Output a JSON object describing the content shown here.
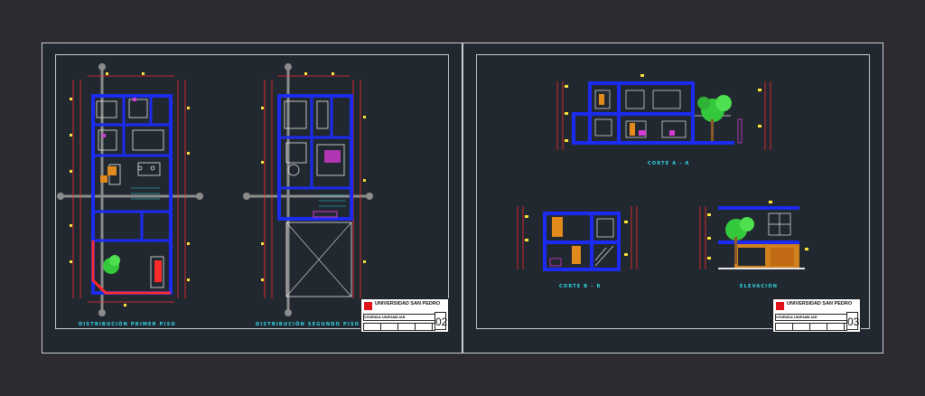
{
  "sheets": [
    {
      "captions": {
        "first_floor": "DISTRIBUCIÓN PRIMER PISO",
        "second_floor": "DISTRIBUCIÓN SEGUNDO PISO"
      },
      "title_block": {
        "university": "UNIVERSIDAD SAN PEDRO",
        "project": "VIVIENDA UNIFAMILIAR",
        "sheet_number": "02"
      }
    },
    {
      "captions": {
        "section_aa": "CORTE A - A",
        "section_bb": "CORTE B - B",
        "elevation": "ELEVACIÓN"
      },
      "title_block": {
        "university": "UNIVERSIDAD SAN PEDRO",
        "project": "VIVIENDA UNIFAMILIAR",
        "sheet_number": "03"
      }
    }
  ],
  "colors": {
    "wall": "#1b2bf0",
    "dimension": "#ffe23a",
    "furniture": "#e7e7e7",
    "accent_red": "#ff2a2a",
    "tree": "#34c83c",
    "axis": "#8c8c8c"
  }
}
